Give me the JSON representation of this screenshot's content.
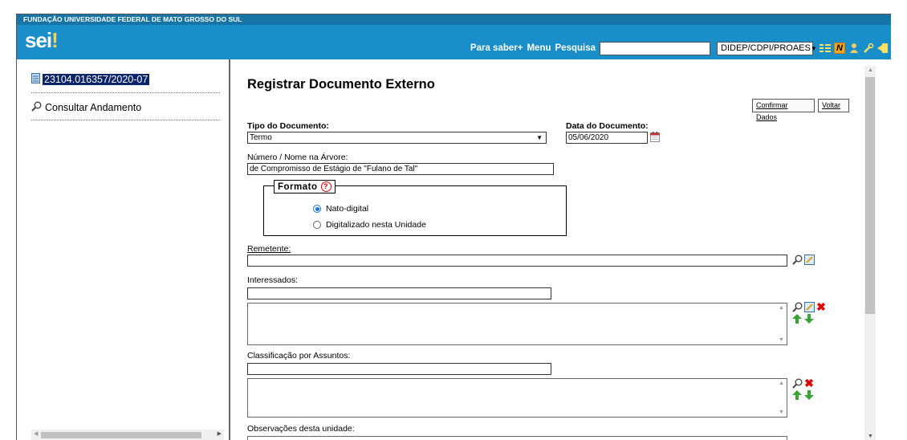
{
  "header": {
    "institution": "FUNDAÇÃO UNIVERSIDADE FEDERAL DE MATO GROSSO DO SUL",
    "logo_text": "sei",
    "logo_dot": "!",
    "links": {
      "saber": "Para saber+",
      "menu": "Menu",
      "pesquisa": "Pesquisa"
    },
    "search_value": "",
    "unit_select": "DIDEP/CDPI/PROAES",
    "icons": [
      "list-icon",
      "notes-icon",
      "user-icon",
      "tools-icon",
      "exit-icon"
    ]
  },
  "tree": {
    "process_number": "23104.016357/2020-07",
    "consultar": "Consultar Andamento"
  },
  "form": {
    "title": "Registrar Documento Externo",
    "buttons": {
      "confirmar": "Confirmar Dados",
      "voltar": "Voltar"
    },
    "tipo_label": "Tipo do Documento:",
    "tipo_value": "Termo",
    "data_label": "Data do Documento:",
    "data_value": "05/06/2020",
    "numero_label": "Número / Nome na Árvore:",
    "numero_value": "de Compromisso de Estágio de \"Fulano de Tal\"",
    "formato_legend": "Formato",
    "formato_options": [
      "Nato-digital",
      "Digitalizado nesta Unidade"
    ],
    "formato_selected": "Nato-digital",
    "remetente_label": "Remetente:",
    "interessados_label": "Interessados:",
    "classificacao_label": "Classificação por Assuntos:",
    "observacoes_label": "Observações desta unidade:"
  },
  "colors": {
    "header_bg": "#1a8ec9",
    "institution_bar": "#1674a6",
    "selected_bg": "#0b246a",
    "accent_red": "#dd0000",
    "arrow_green": "#3aa335"
  }
}
